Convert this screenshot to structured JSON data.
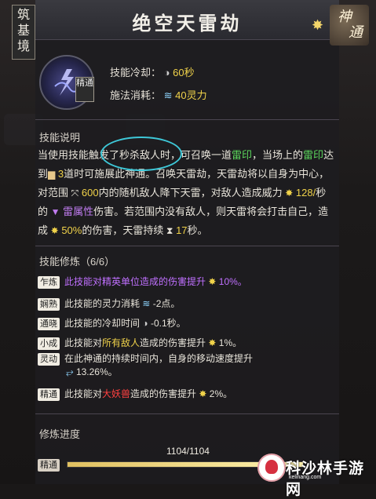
{
  "header": {
    "title": "绝空天雷劫",
    "realm": "筑基境",
    "shentong_top": "神",
    "shentong_bottom": "通"
  },
  "skill": {
    "badge": "精通"
  },
  "stats": {
    "cooldown_label": "技能冷却：",
    "cooldown_value": "60秒",
    "cost_label": "施法消耗：",
    "cost_value": "40灵力"
  },
  "description": {
    "section_title": "技能说明",
    "p1": "当使用技能触发了秒杀敌人时，可召唤一道",
    "kw_leiyin1": "雷印",
    "p2": "，当场上的",
    "kw_leiyin2": "雷印",
    "p3": "达到",
    "val_3": "3",
    "p4": "道时可施展此神通。召唤天雷劫，天雷劫将以自身为中心，对范围",
    "val_600": "600",
    "p5": "内的随机敌人降下天雷，对敌人造成威力",
    "val_128": "128/",
    "p6": "秒的",
    "kw_lei": "雷属性",
    "p7": "伤害。若范围内没有敌人，则天雷将会打击自己，造成",
    "val_50": "50%",
    "p8": "的伤害，天雷持续",
    "val_17": "17",
    "p9": "秒。"
  },
  "cultivation": {
    "section_title": "技能修炼（6/6）",
    "rows": [
      {
        "tag": "乍炼",
        "text": "此技能对精英单位造成的伤害提升",
        "val": "10%。"
      },
      {
        "tag": "娴熟",
        "text": "此技能的灵力消耗",
        "val": "-2点。"
      },
      {
        "tag": "通晓",
        "text": "此技能的冷却时间",
        "val": "-0.1秒。"
      },
      {
        "tag": "小成",
        "pre": "此技能对",
        "kw": "所有敌人",
        "text": "造成的伤害提升",
        "val": "1%。"
      },
      {
        "tag": "灵动",
        "text": "在此神通的持续时间内，自身的移动速度提升",
        "val": "13.26%。"
      },
      {
        "tag": "精通",
        "pre": "此技能对",
        "kw": "大妖兽",
        "text": "造成的伤害提升",
        "val": "2%。"
      }
    ]
  },
  "progress": {
    "label": "修炼进度",
    "value_text": "1104/1104",
    "tag": "精通",
    "fraction": 1.0
  },
  "watermark": {
    "text": "科沙林手游网",
    "sub": "kelinang.com"
  },
  "colors": {
    "gold": "#f0d24a",
    "green": "#5cd65c",
    "purple": "#c07cf0",
    "cyan_circle": "#3ec8d8",
    "red": "#ff4040"
  }
}
